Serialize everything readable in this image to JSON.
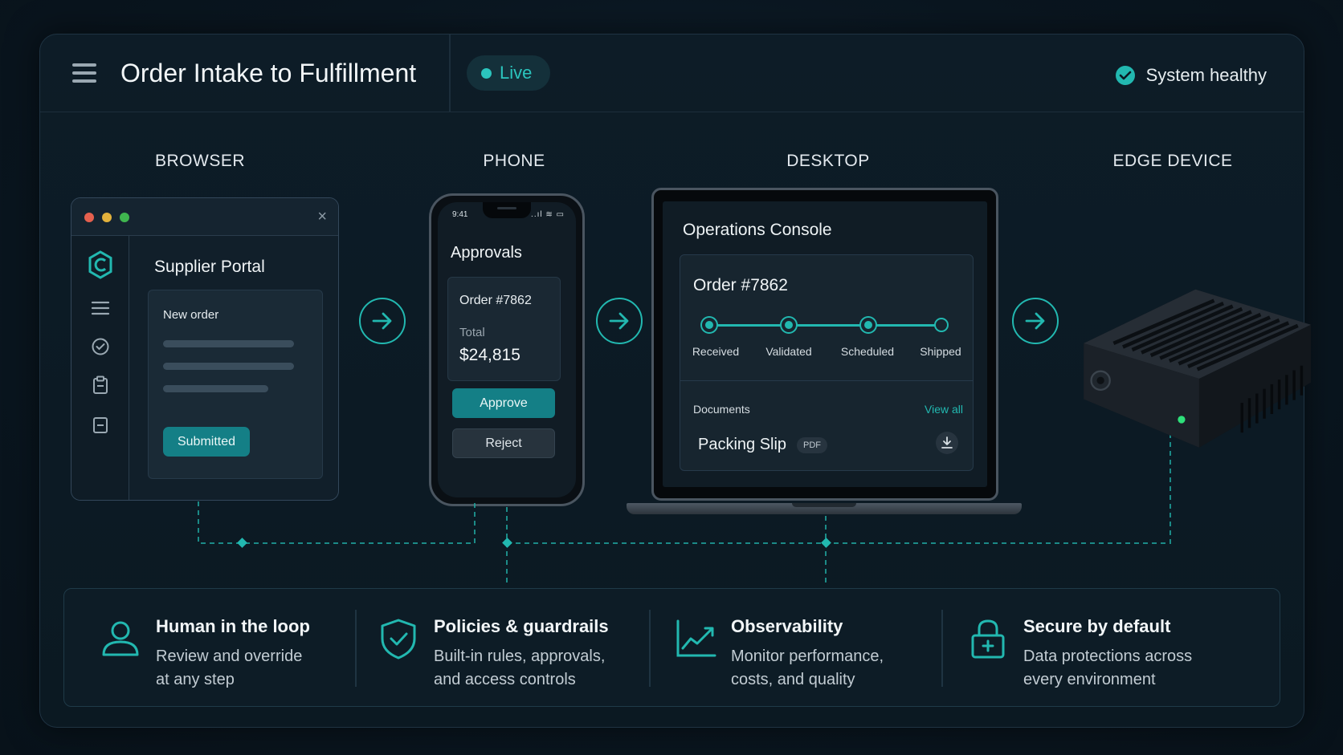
{
  "header": {
    "title": "Order Intake to Fulfillment",
    "live_label": "Live",
    "health_label": "System healthy"
  },
  "columns": {
    "browser": "BROWSER",
    "phone": "PHONE",
    "desktop": "DESKTOP",
    "edge": "EDGE DEVICE"
  },
  "browser": {
    "portal_title": "Supplier Portal",
    "card_label": "New order",
    "submitted_label": "Submitted",
    "close_glyph": "×"
  },
  "phone": {
    "time": "9:41",
    "status_glyphs": "..ıl ≋ ▭",
    "title": "Approvals",
    "order": "Order #7862",
    "total_label": "Total",
    "total_value": "$24,815",
    "approve_label": "Approve",
    "reject_label": "Reject"
  },
  "desktop": {
    "console_title": "Operations Console",
    "order": "Order #7862",
    "steps": [
      "Received",
      "Validated",
      "Scheduled",
      "Shipped"
    ],
    "documents_label": "Documents",
    "view_all": "View all",
    "document_name": "Packing Slip",
    "document_type": "PDF"
  },
  "features": [
    {
      "title": "Human in the loop",
      "line1": "Review and override",
      "line2": "at any step",
      "icon": "user-icon"
    },
    {
      "title": "Policies & guardrails",
      "line1": "Built-in rules, approvals,",
      "line2": "and access controls",
      "icon": "shield-check-icon"
    },
    {
      "title": "Observability",
      "line1": "Monitor performance,",
      "line2": "costs, and quality",
      "icon": "line-chart-icon"
    },
    {
      "title": "Secure by default",
      "line1": "Data protections across",
      "line2": "every environment",
      "icon": "lock-icon"
    }
  ],
  "colors": {
    "accent": "#22b8b0",
    "background": "#0a1620",
    "panel": "#0d1c27",
    "button": "#147f86"
  }
}
